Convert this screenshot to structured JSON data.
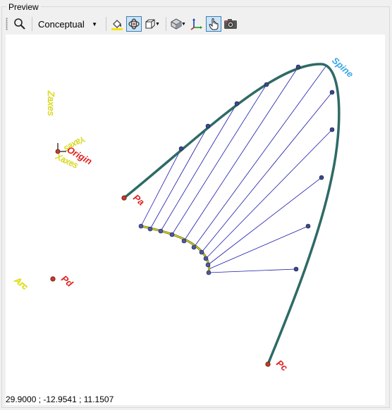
{
  "panel": {
    "title": "Preview"
  },
  "toolbar": {
    "visual_style_value": "Conceptual",
    "icons": [
      "zoom-icon",
      "fill-icon",
      "orbit-icon",
      "view-cube-icon",
      "render-mode-icon",
      "axes-icon",
      "hand-pointer-icon",
      "camera-icon"
    ]
  },
  "canvas": {
    "labels": {
      "spine": "Spine",
      "pa": "Pa",
      "pc": "Pc",
      "pd": "Pd",
      "arc": "Arc",
      "origin": "Origin",
      "axes_x": "Xaxes",
      "axes_y": "Yaxes",
      "axes_z": "Zaxes"
    },
    "status_coordinates": "29.9000 ; -12.9541 ; 11.1507"
  },
  "colors": {
    "curve": "#2e6a66",
    "rulings": "#1a1aaa",
    "handle": "#3a4a8a",
    "point_label": "#e02020",
    "spine_label": "#3aa6e6",
    "axis_label": "#f0f000",
    "active_button": "#cce4f7"
  }
}
